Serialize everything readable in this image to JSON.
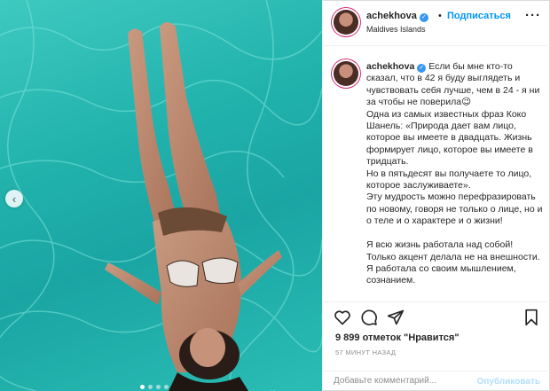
{
  "post": {
    "username": "achekhova",
    "verified_icon": "verified-badge-icon",
    "separator": "•",
    "follow_label": "Подписаться",
    "location": "Maldives Islands",
    "more_icon": "more-options-icon"
  },
  "caption": {
    "username": "achekhova",
    "text": "Если бы мне кто-то сказал, что в 42 я буду выглядеть и чувствовать себя лучше, чем в 24 - я ни за чтобы не поверила😉\nОдна из самых известных фраз Коко Шанель: «Природа дает вам лицо, которое вы имеете в двадцать. Жизнь формирует лицо, которое вы имеете в тридцать.\nНо в пятьдесят вы получаете то лицо, которое заслуживаете».\nЭту мудрость можно перефразировать по новому, говоря не только о лице, но и о теле и о характере и о жизни!\n\nЯ всю жизнь работала над собой! Только акцент делала не на внешности. Я работала со своим мышлением, сознанием."
  },
  "actions": {
    "like_icon": "heart-icon",
    "comment_icon": "comment-icon",
    "share_icon": "share-icon",
    "save_icon": "bookmark-icon"
  },
  "likes_text": "9 899 отметок \"Нравится\"",
  "timestamp": "57 МИНУТ НАЗАД",
  "comment": {
    "placeholder": "Добавьте комментарий...",
    "publish_label": "Опубликовать"
  },
  "carousel": {
    "prev_icon": "chevron-left-icon",
    "slide_count": 4,
    "active_index": 0
  },
  "colors": {
    "accent": "#0095f6",
    "publish_disabled": "#b2dffc",
    "water": "#22b3ad"
  }
}
